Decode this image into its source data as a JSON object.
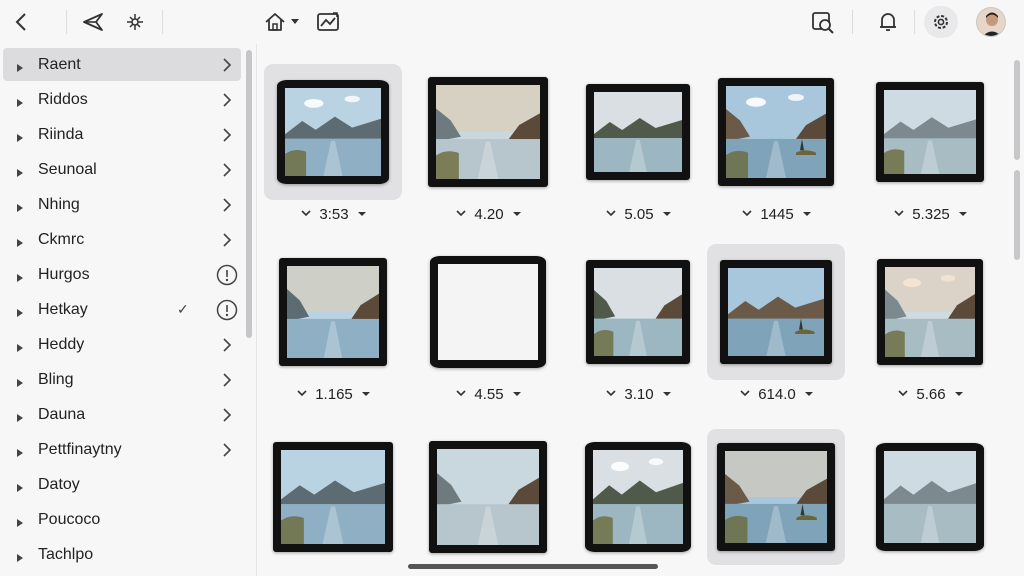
{
  "toolbar": {
    "icons": [
      "back-icon",
      "navigate-icon",
      "sparkle-icon",
      "home-icon",
      "chevron-down-icon",
      "image-sync-icon",
      "image-search-icon",
      "bell-icon",
      "gear-icon",
      "avatar"
    ]
  },
  "sidebar": {
    "items": [
      {
        "label": "Raent",
        "right": "chevron",
        "selected": true
      },
      {
        "label": "Riddos",
        "right": "chevron"
      },
      {
        "label": "Riinda",
        "right": "chevron"
      },
      {
        "label": "Seunoal",
        "right": "chevron"
      },
      {
        "label": "Nhing",
        "right": "chevron"
      },
      {
        "label": "Ckmrc",
        "right": "chevron"
      },
      {
        "label": "Hurgos",
        "right": "info"
      },
      {
        "label": "Hetkay",
        "right": "info",
        "check": "✓"
      },
      {
        "label": "Heddy",
        "right": "chevron"
      },
      {
        "label": "Bling",
        "right": "chevron"
      },
      {
        "label": "Dauna",
        "right": "chevron"
      },
      {
        "label": "Pettfinaytny",
        "right": "chevron"
      },
      {
        "label": "Datoy",
        "right": "none"
      },
      {
        "label": "Poucoco",
        "right": "none"
      },
      {
        "label": "Tachlpo",
        "right": "none"
      }
    ]
  },
  "gallery": {
    "items": [
      {
        "value": "3:53",
        "lead_caret": true,
        "highlight": true
      },
      {
        "value": "4.20",
        "lead_caret": true
      },
      {
        "value": "5.05",
        "lead_caret": true
      },
      {
        "value": "1445",
        "lead_caret": true
      },
      {
        "value": "5.325",
        "lead_caret": true
      },
      {
        "value": "1.165",
        "lead_caret": true
      },
      {
        "value": "4.55",
        "lead_caret": true
      },
      {
        "value": "3.10",
        "lead_caret": true
      },
      {
        "value": "614.0",
        "lead_caret": true,
        "highlight": true
      },
      {
        "value": "5.66",
        "lead_caret": true
      },
      {
        "value": "",
        "lead_caret": false
      },
      {
        "value": "",
        "lead_caret": false
      },
      {
        "value": "",
        "lead_caret": false
      },
      {
        "value": "",
        "lead_caret": false,
        "highlight": true
      },
      {
        "value": "",
        "lead_caret": false
      }
    ]
  },
  "colors": {
    "background": "#f7f7f8",
    "selected": "#dcdcde",
    "frame": "#111111",
    "tile_highlight": "#e1e1e3"
  }
}
